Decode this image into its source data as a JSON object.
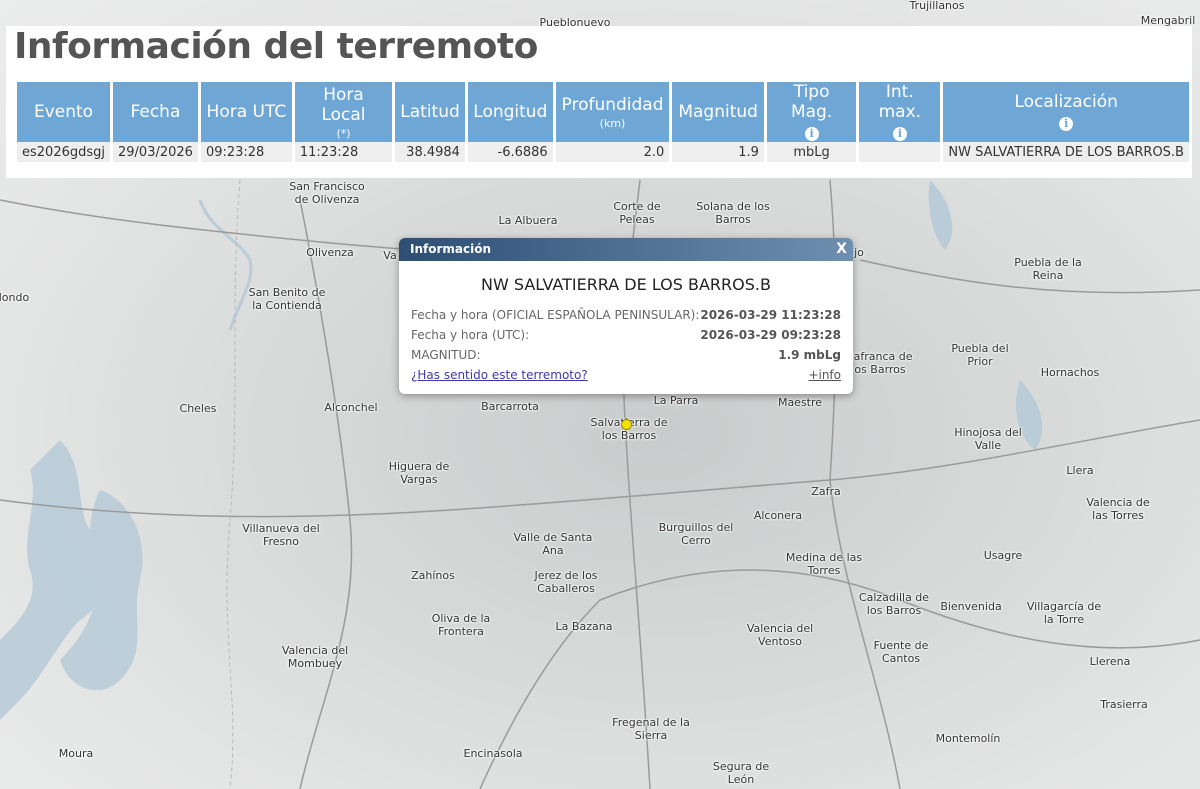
{
  "panel": {
    "title": "Información del terremoto",
    "headers": {
      "evento": "Evento",
      "fecha": "Fecha",
      "hora_utc": "Hora UTC",
      "hora_local": "Hora Local",
      "hora_local_sub": "(*)",
      "latitud": "Latitud",
      "longitud": "Longitud",
      "profundidad": "Profundidad",
      "profundidad_sub": "(km)",
      "magnitud": "Magnitud",
      "tipo_mag": "Tipo Mag.",
      "int_max": "Int. max.",
      "localizacion": "Localización",
      "info_glyph": "i"
    },
    "row": {
      "evento": "es2026gdsgj",
      "fecha": "29/03/2026",
      "hora_utc": "09:23:28",
      "hora_local": "11:23:28",
      "latitud": "38.4984",
      "longitud": "-6.6886",
      "profundidad": "2.0",
      "magnitud": "1.9",
      "tipo_mag": "mbLg",
      "int_max": "",
      "localizacion": "NW SALVATIERRA DE LOS BARROS.B"
    }
  },
  "popup": {
    "header": "Información",
    "close_label": "X",
    "title": "NW SALVATIERRA DE LOS BARROS.B",
    "rows": [
      {
        "label": "Fecha y hora (OFICIAL ESPAÑOLA PENINSULAR):",
        "value": "2026-03-29 11:23:28"
      },
      {
        "label": "Fecha y hora (UTC):",
        "value": "2026-03-29 09:23:28"
      },
      {
        "label": "MAGNITUD:",
        "value": "1.9 mbLg"
      }
    ],
    "felt_link": "¿Has sentido este terremoto?",
    "more_link": "+info"
  },
  "map": {
    "places": {
      "pueblonuevo": "Pueblonuevo",
      "trujillanos": "Trujillanos",
      "mengabril": "Mengabril",
      "san_francisco": "San Francisco\nde Olivenza",
      "la_albuera": "La Albuera",
      "corte_de_peleas": "Corte de\nPeleas",
      "solana": "Solana de los\nBarros",
      "olivenza": "Olivenza",
      "va": "Va",
      "jo": "jo",
      "puebla_reina": "Puebla de la\nReina",
      "dondo": "dondo",
      "san_benito": "San Benito de\nla Contienda",
      "villafranca": "llafranca de\nos Barros",
      "puebla_prior": "Puebla del\nPrior",
      "hornachos": "Hornachos",
      "cheles": "Cheles",
      "alconchel": "Alconchel",
      "barcarrota": "Barcarrota",
      "la_parra": "La Parra",
      "maestre": "Maestre",
      "salvatierra": "Salvatierra de\nlos Barros",
      "hinojosa": "Hinojosa del\nValle",
      "higuera": "Higuera de\nVargas",
      "llera": "Llera",
      "zafra": "Zafra",
      "valencia_torres": "Valencia de\nlas Torres",
      "villanueva_fresno": "Villanueva del\nFresno",
      "alconera": "Alconera",
      "valle_santa_ana": "Valle de Santa\nAna",
      "burguillos": "Burguillos del\nCerro",
      "usagre": "Usagre",
      "medina_torres": "Medina de las\nTorres",
      "zahinos": "Zahínos",
      "jerez": "Jerez de los\nCaballeros",
      "calzadilla": "Calzadilla de\nlos Barros",
      "bienvenida": "Bienvenida",
      "villagarcia": "Villagarcía de\nla Torre",
      "oliva": "Oliva de la\nFrontera",
      "la_bazana": "La Bazana",
      "valencia_ventoso": "Valencia del\nVentoso",
      "fuente_cantos": "Fuente de\nCantos",
      "llerena": "Llerena",
      "valencia_mombuey": "Valencia del\nMombuey",
      "trasierra": "Trasierra",
      "fregenal": "Fregenal de la\nSierra",
      "moura": "Moura",
      "encinasola": "Encinasola",
      "montemolin": "Montemolín",
      "segura": "Segura de\nLeón"
    },
    "water_color": "#b9ccd8",
    "road_color": "#9a9a9a",
    "epicenter_color": "#f6e000"
  }
}
